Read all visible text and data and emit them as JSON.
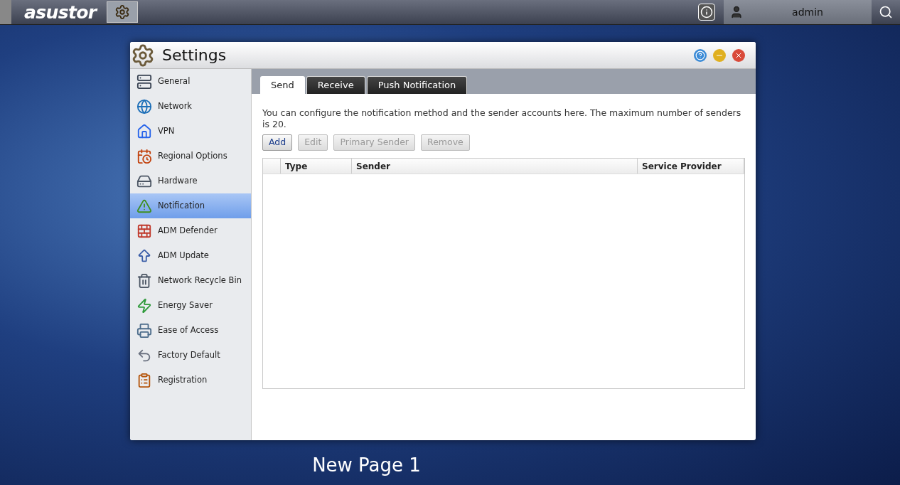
{
  "taskbar": {
    "logo": "asustor",
    "user": "admin"
  },
  "window": {
    "title": "Settings"
  },
  "sidebar": {
    "items": [
      {
        "label": "General",
        "selected": false
      },
      {
        "label": "Network",
        "selected": false
      },
      {
        "label": "VPN",
        "selected": false
      },
      {
        "label": "Regional Options",
        "selected": false
      },
      {
        "label": "Hardware",
        "selected": false
      },
      {
        "label": "Notification",
        "selected": true
      },
      {
        "label": "ADM Defender",
        "selected": false
      },
      {
        "label": "ADM Update",
        "selected": false
      },
      {
        "label": "Network Recycle Bin",
        "selected": false
      },
      {
        "label": "Energy Saver",
        "selected": false
      },
      {
        "label": "Ease of Access",
        "selected": false
      },
      {
        "label": "Factory Default",
        "selected": false
      },
      {
        "label": "Registration",
        "selected": false
      }
    ]
  },
  "tabs": [
    {
      "label": "Send",
      "selected": true
    },
    {
      "label": "Receive",
      "selected": false
    },
    {
      "label": "Push Notification",
      "selected": false
    }
  ],
  "description": "You can configure the notification method and the sender accounts here. The maximum number of senders is 20.",
  "buttons": [
    {
      "label": "Add",
      "disabled": false
    },
    {
      "label": "Edit",
      "disabled": true
    },
    {
      "label": "Primary Sender",
      "disabled": true
    },
    {
      "label": "Remove",
      "disabled": true
    }
  ],
  "table": {
    "columns": [
      "Type",
      "Sender",
      "Service Provider"
    ]
  },
  "desktop_label": "New Page 1"
}
